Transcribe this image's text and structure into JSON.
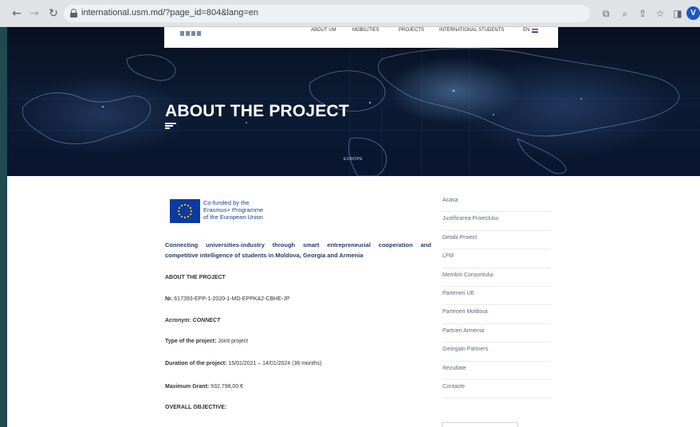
{
  "browser": {
    "url": "international.usm.md/?page_id=804&lang=en",
    "profile_initial": "V"
  },
  "site_nav": {
    "about": "ABOUT UM",
    "mobilities": "MOBILITIES",
    "projects": "PROJECTS",
    "international": "INTERNATIONAL STUDENTS",
    "language": "EN"
  },
  "hero": {
    "title": "ABOUT THE PROJECT",
    "map_label": "EUROPE"
  },
  "eu_logo": {
    "line1": "Co-funded by the",
    "line2": "Erasmus+ Programme",
    "line3": "of the European Union"
  },
  "article": {
    "headline_words": [
      "Connecting",
      "universities-industry",
      "through",
      "smart",
      "entrepreneurial",
      "cooperation",
      "and"
    ],
    "headline_line2": "competitive intelligence of students in Moldova, Georgia and Armenia",
    "section_about": "ABOUT THE PROJECT",
    "nr_label": "Nr.",
    "nr_value": " 617393-EPP-1-2020-1-MD-EPPKA2-CBHE-JP",
    "acronym_label": "Acronym:",
    "acronym_value": " CONNECT",
    "type_label": "Type of the project:",
    "type_value": " Joint project",
    "duration_label": "Duration of the project:",
    "duration_value": " 15/01/2021 – 14/01/2024 (36 months)",
    "grant_label": "Maximum Grant:",
    "grant_value": " 932.798,00 €",
    "section_objective": "OVERALL OBJECTIVE:"
  },
  "sidebar": {
    "items": [
      "Acasa",
      "Justificarea Proiectului",
      "Detalii Proiect",
      "LFM",
      "Membrii Consortiului",
      "Parteneri UE",
      "Parteneri Moldova",
      "Partneri Armenia",
      "Georgian Partners",
      "Rezultate",
      "Contacte"
    ]
  },
  "colors": {
    "chrome_bg": "#dfe3e6",
    "hero_bg": "#0a1630",
    "headline": "#2a3a6a",
    "eu_blue": "#0d3aa0",
    "eu_star": "#ffcc00"
  }
}
